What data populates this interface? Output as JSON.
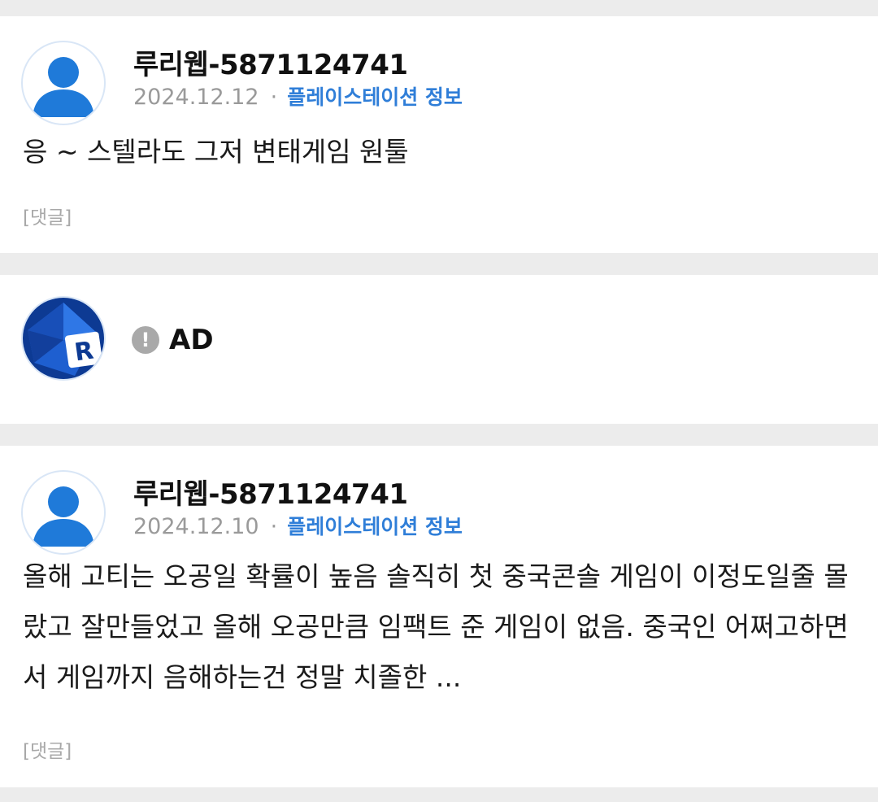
{
  "posts": [
    {
      "author": "루리웹-5871124741",
      "date": "2024.12.12",
      "separator": "·",
      "board": "플레이스테이션 정보",
      "content": "응 ~ 스텔라도 그저 변태게임 원툴",
      "reply_label": "[댓글]"
    },
    {
      "author": "루리웹-5871124741",
      "date": "2024.12.10",
      "separator": "·",
      "board": "플레이스테이션 정보",
      "content": "올해 고티는 오공일 확률이 높음 솔직히 첫 중국콘솔 게임이 이정도일줄 몰랐고 잘만들었고 올해 오공만큼 임팩트 준 게임이 없음. 중국인 어쩌고하면서 게임까지 음해하는건 정말 치졸한 ...",
      "reply_label": "[댓글]"
    }
  ],
  "ad": {
    "icon_glyph": "!",
    "label": "AD",
    "logo_letter": "R"
  },
  "colors": {
    "accent": "#2f7ed8",
    "avatar_blue": "#1f7ad9",
    "muted": "#9a9a9a",
    "separator_bg": "#ececec"
  }
}
